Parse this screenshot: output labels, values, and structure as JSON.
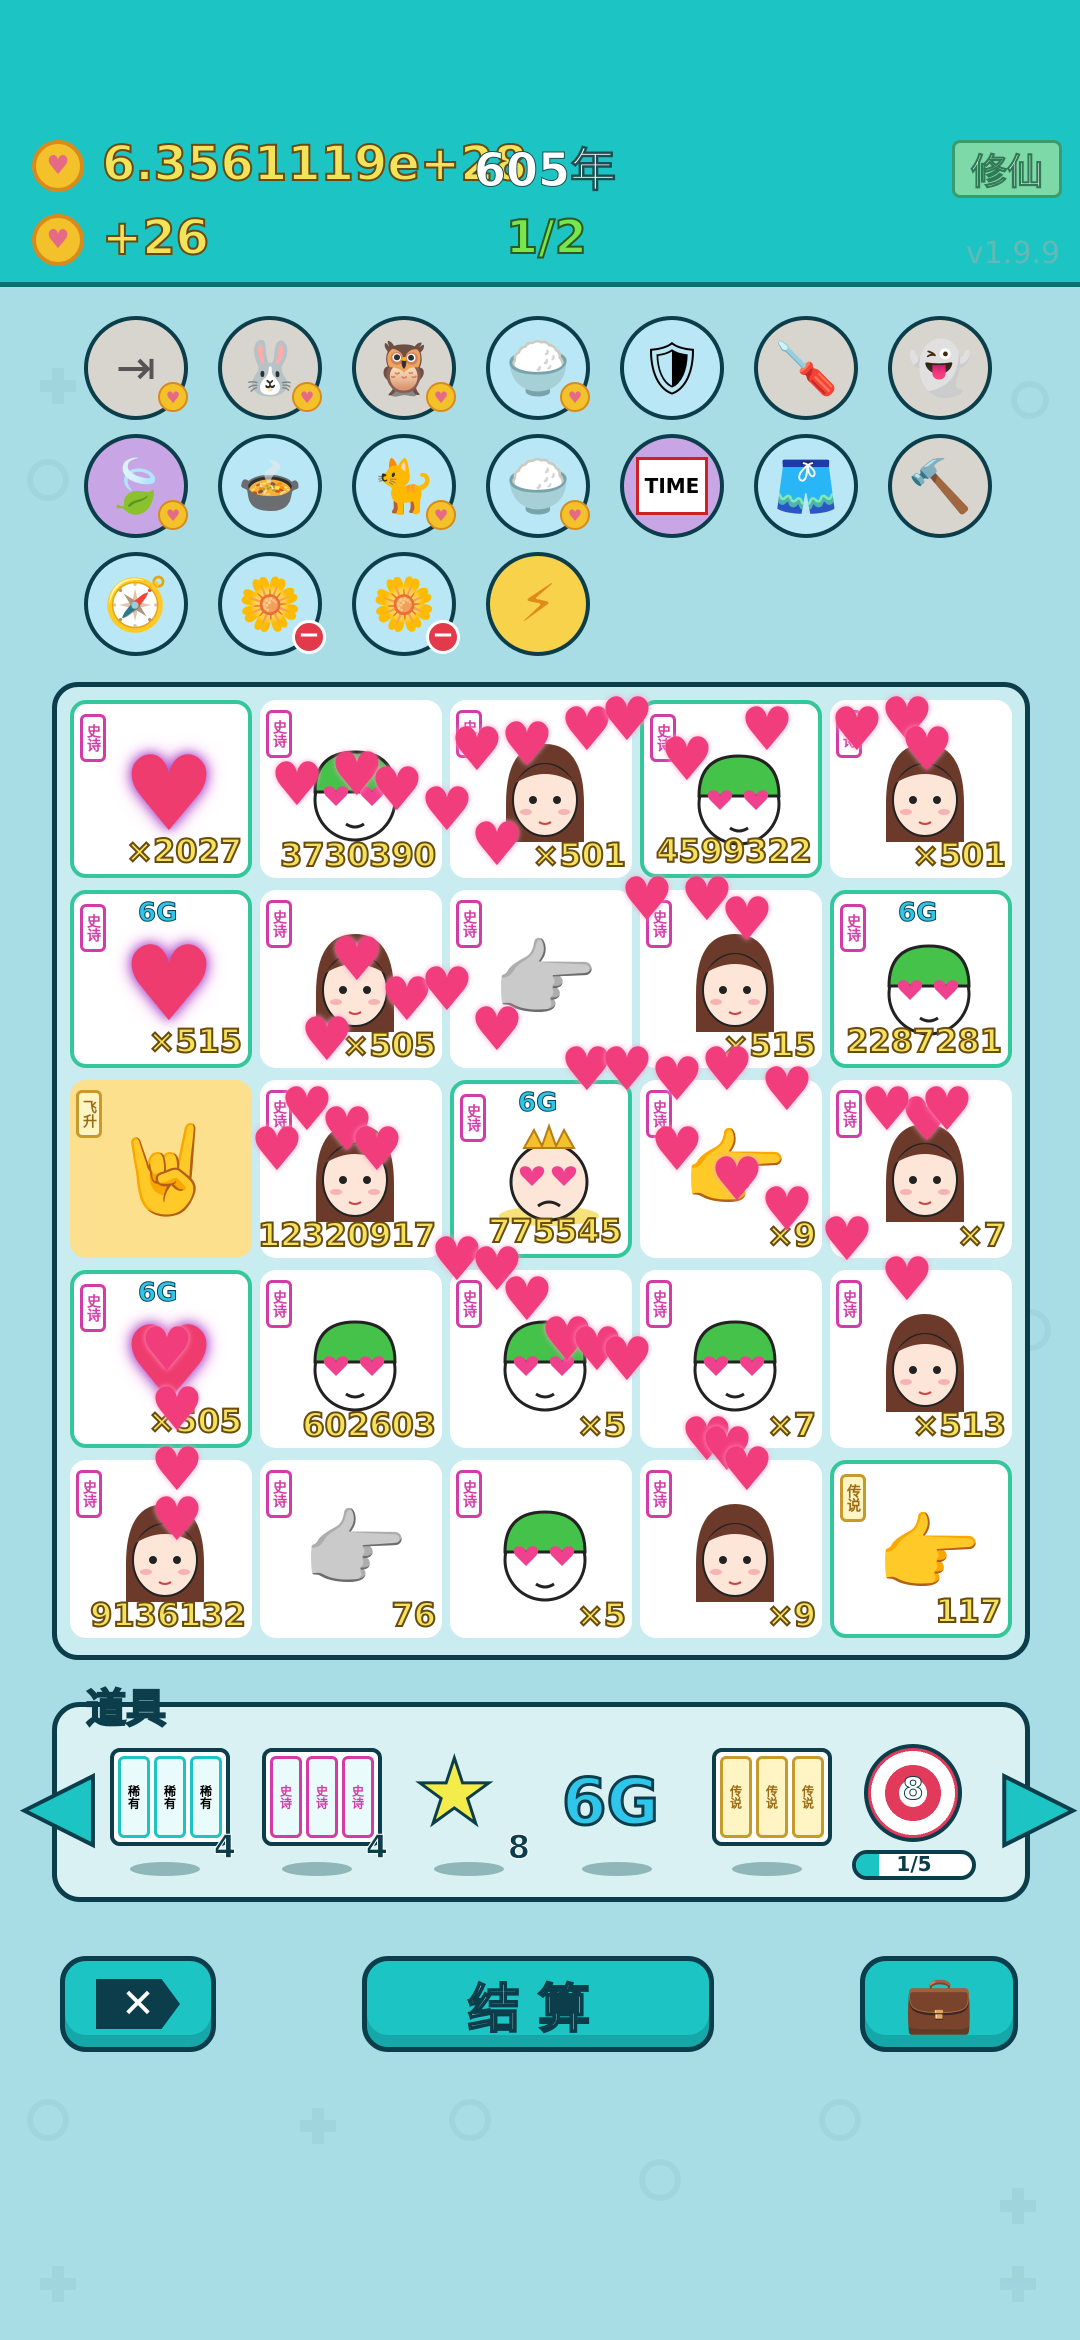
{
  "header": {
    "coins_total": "6.3561119e+28",
    "coins_rate": "+26",
    "year": "605年",
    "stage": "1/2",
    "cultivate_label": "修仙",
    "version": "v1.9.9"
  },
  "tools": [
    {
      "name": "skip",
      "icon": "skip-icon"
    },
    {
      "name": "rabbit",
      "icon": "rabbit-icon"
    },
    {
      "name": "owls",
      "icon": "owls-icon"
    },
    {
      "name": "rice",
      "icon": "rice-bowl-icon"
    },
    {
      "name": "shield",
      "icon": "shield-wrench-icon"
    },
    {
      "name": "screwdriver",
      "icon": "screwdriver-icon"
    },
    {
      "name": "ghost",
      "icon": "ghost-icon"
    },
    {
      "name": "leaf",
      "icon": "leaf-icon"
    },
    {
      "name": "pot",
      "icon": "duck-pot-icon"
    },
    {
      "name": "cat",
      "icon": "cat-icon"
    },
    {
      "name": "rice2",
      "icon": "rice-bowl-icon"
    },
    {
      "name": "time",
      "icon": "time-magazine-icon",
      "text": "TIME"
    },
    {
      "name": "skirt",
      "icon": "skirt-icon"
    },
    {
      "name": "hammer",
      "icon": "hammer-icon"
    },
    {
      "name": "compass",
      "icon": "compass-icon"
    },
    {
      "name": "flower1",
      "icon": "flower-pot-icon"
    },
    {
      "name": "flower2",
      "icon": "flower-pot-icon"
    },
    {
      "name": "lightning",
      "icon": "lightning-icon"
    }
  ],
  "board": {
    "cells": [
      {
        "tag": "史诗",
        "art": "heart",
        "count": "×2027"
      },
      {
        "tag": "史诗",
        "art": "face-green",
        "count": "3730390"
      },
      {
        "tag": "史诗",
        "art": "girl",
        "count": "×501"
      },
      {
        "tag": "史诗",
        "art": "face-green",
        "count": "4599322"
      },
      {
        "tag": "史诗",
        "art": "girl",
        "count": "×501"
      },
      {
        "tag": "史诗",
        "art": "heart",
        "badge": "6G",
        "count": "×515"
      },
      {
        "tag": "史诗",
        "art": "girl",
        "count": "×505"
      },
      {
        "tag": "史诗",
        "art": "hand-grey",
        "count": ""
      },
      {
        "tag": "史诗",
        "art": "girl",
        "count": "×515"
      },
      {
        "tag": "史诗",
        "art": "face-green",
        "badge": "6G",
        "count": "2287281"
      },
      {
        "tag": "飞升",
        "art": "hand-gold",
        "count": ""
      },
      {
        "tag": "史诗",
        "art": "girl",
        "count": "12320917"
      },
      {
        "tag": "史诗",
        "art": "king",
        "badge": "6G",
        "count": "775545"
      },
      {
        "tag": "史诗",
        "art": "hand-yellow",
        "count": "×9"
      },
      {
        "tag": "史诗",
        "art": "girl",
        "count": "×7"
      },
      {
        "tag": "史诗",
        "art": "heart",
        "badge": "6G",
        "count": "×505"
      },
      {
        "tag": "史诗",
        "art": "face-green",
        "count": "602603"
      },
      {
        "tag": "史诗",
        "art": "face-green",
        "count": "×5"
      },
      {
        "tag": "史诗",
        "art": "face-green",
        "count": "×7"
      },
      {
        "tag": "史诗",
        "art": "girl",
        "count": "×513"
      },
      {
        "tag": "史诗",
        "art": "girl",
        "count": "9136132"
      },
      {
        "tag": "史诗",
        "art": "hand-grey",
        "count": "76"
      },
      {
        "tag": "史诗",
        "art": "face-green",
        "count": "×5"
      },
      {
        "tag": "史诗",
        "art": "girl",
        "count": "×9"
      },
      {
        "tag": "传说",
        "art": "hand-yellow",
        "count": "117"
      }
    ]
  },
  "props": {
    "title": "道具",
    "items": [
      {
        "name": "rare-cards",
        "label": "稀有",
        "qty": "4"
      },
      {
        "name": "epic-cards",
        "label": "史诗",
        "qty": "4"
      },
      {
        "name": "star",
        "qty": "8"
      },
      {
        "name": "6g",
        "label": "6G",
        "qty": ""
      },
      {
        "name": "legend-cards",
        "label": "传说",
        "qty": ""
      },
      {
        "name": "target",
        "label": "8",
        "progress": "1/5",
        "progress_fraction": 0.2
      }
    ]
  },
  "buttons": {
    "settle_label": "结算"
  }
}
